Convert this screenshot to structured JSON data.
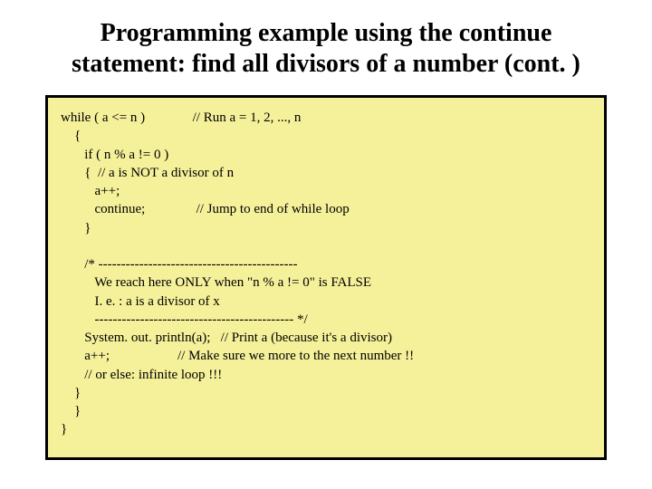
{
  "title": "Programming example using the continue statement: find all divisors of a number (cont. )",
  "code": {
    "l1": "while ( a <= n )              // Run a = 1, 2, ..., n",
    "l2": "    {",
    "l3": "       if ( n % a != 0 )",
    "l4": "       {  // a is NOT a divisor of n",
    "l5": "          a++;",
    "l6": "          continue;               // Jump to end of while loop",
    "l7": "       }",
    "l8": "",
    "l9": "       /* --------------------------------------------",
    "l10": "          We reach here ONLY when \"n % a != 0\" is FALSE",
    "l11": "          I. e. : a is a divisor of x",
    "l12": "          -------------------------------------------- */",
    "l13": "       System. out. println(a);   // Print a (because it's a divisor)",
    "l14": "       a++;                    // Make sure we more to the next number !!",
    "l15": "       // or else: infinite loop !!!",
    "l16": "    }",
    "l17": "    }",
    "l18": "}"
  }
}
